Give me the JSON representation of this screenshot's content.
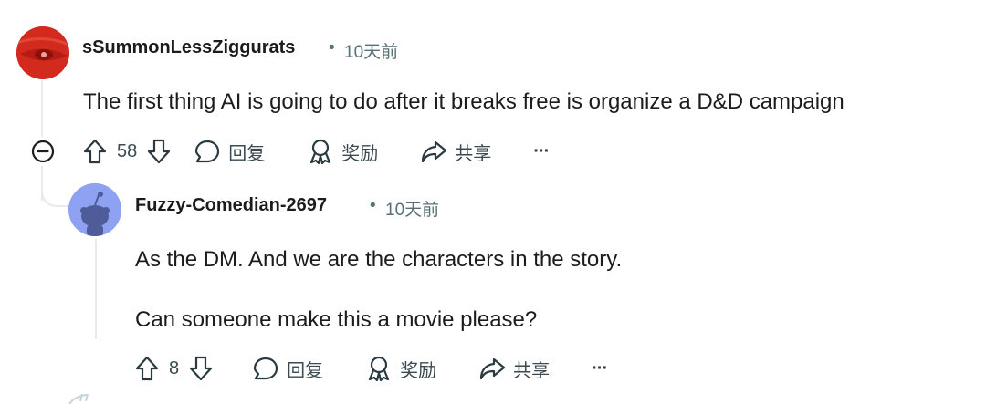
{
  "comment1": {
    "username": "sSummonLessZiggurats",
    "separator": "•",
    "time": "10天前",
    "text": "The first thing AI is going to do after it breaks free is organize a D&D campaign",
    "score": "58",
    "reply_label": "回复",
    "award_label": "奖励",
    "share_label": "共享",
    "more_label": "···",
    "avatar_color": "#d8281f"
  },
  "comment2": {
    "username": "Fuzzy-Comedian-2697",
    "separator": "•",
    "time": "10天前",
    "paragraphs": [
      "As the DM. And we are the characters in the story.",
      "Can someone make this a movie please?"
    ],
    "score": "8",
    "reply_label": "回复",
    "award_label": "奖励",
    "share_label": "共享",
    "more_label": "···",
    "avatar_color": "#8a9ff0"
  },
  "colors": {
    "text": "#1c1c1c",
    "meta": "#576f76",
    "thread_line": "#e5ebee"
  }
}
